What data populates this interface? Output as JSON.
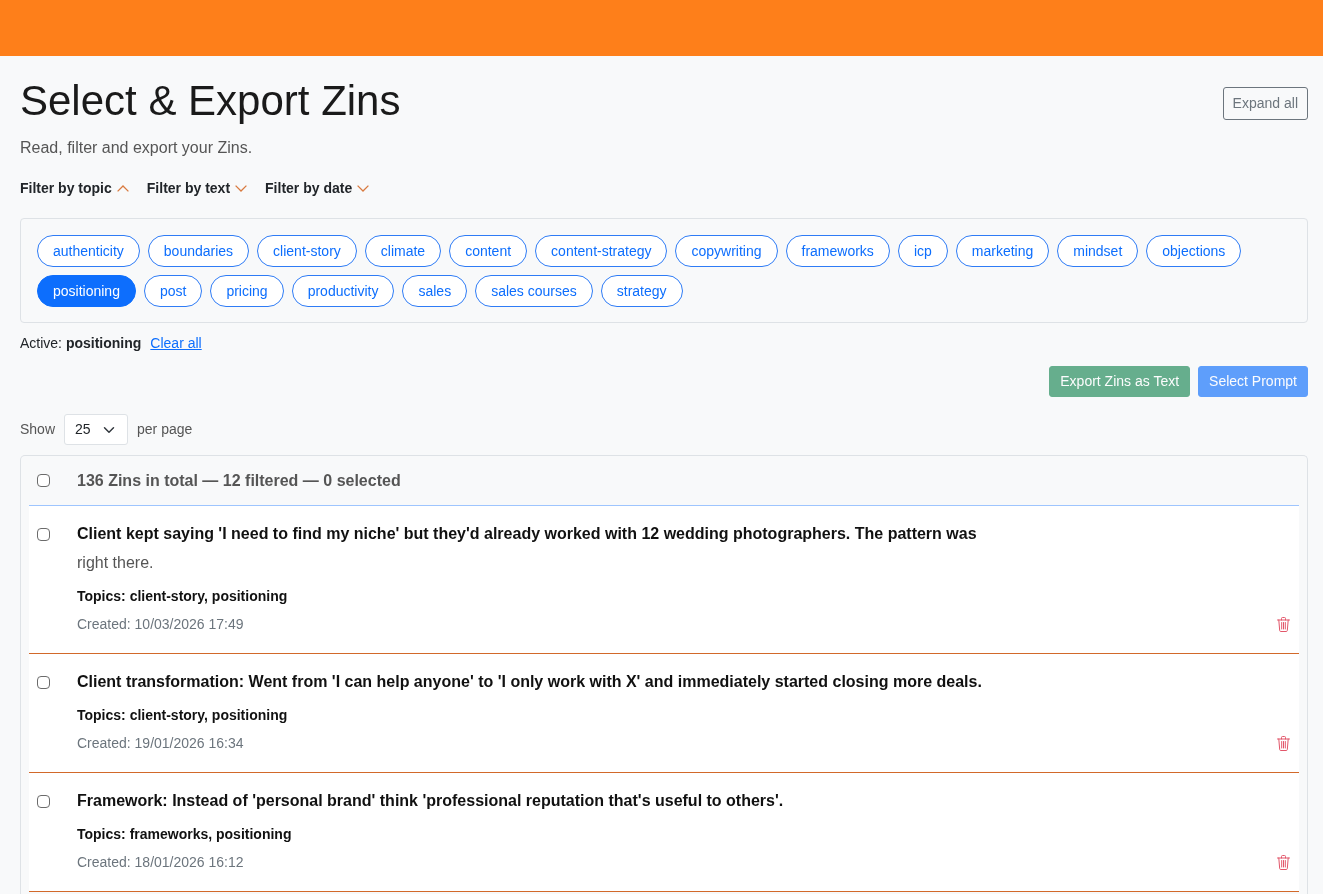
{
  "page": {
    "title": "Select & Export Zins",
    "subtitle": "Read, filter and export your Zins.",
    "expand_button": "Expand all"
  },
  "filters": [
    {
      "kind": "topic",
      "label": "Filter by topic",
      "expanded": true
    },
    {
      "kind": "text",
      "label": "Filter by text",
      "expanded": false
    },
    {
      "kind": "date",
      "label": "Filter by date",
      "expanded": false
    }
  ],
  "topics": [
    {
      "label": "authenticity",
      "selected": false
    },
    {
      "label": "boundaries",
      "selected": false
    },
    {
      "label": "client-story",
      "selected": false
    },
    {
      "label": "climate",
      "selected": false
    },
    {
      "label": "content",
      "selected": false
    },
    {
      "label": "content-strategy",
      "selected": false
    },
    {
      "label": "copywriting",
      "selected": false
    },
    {
      "label": "frameworks",
      "selected": false
    },
    {
      "label": "icp",
      "selected": false
    },
    {
      "label": "marketing",
      "selected": false
    },
    {
      "label": "mindset",
      "selected": false
    },
    {
      "label": "objections",
      "selected": false
    },
    {
      "label": "positioning",
      "selected": true
    },
    {
      "label": "post",
      "selected": false
    },
    {
      "label": "pricing",
      "selected": false
    },
    {
      "label": "productivity",
      "selected": false
    },
    {
      "label": "sales",
      "selected": false
    },
    {
      "label": "sales courses",
      "selected": false
    },
    {
      "label": "strategy",
      "selected": false
    }
  ],
  "active_filter": {
    "text": "Active: **positioning**",
    "clear_link": "Clear all"
  },
  "actions": [
    {
      "kind": "success",
      "label": "Export Zins as Text",
      "disabled": true
    },
    {
      "kind": "primary",
      "label": "Select Prompt",
      "disabled": true
    }
  ],
  "page_size": {
    "label": "Show",
    "value": "25",
    "suffix": "per page"
  },
  "list": {
    "select_all_checked": false,
    "summary": "136 Zins in total — 12 filtered — 0 selected",
    "items": [
      {
        "checked": false,
        "title": "Client kept saying 'I need to find my niche' but they'd already worked with 12 wedding photographers. The pattern was",
        "excerpt": "right there.",
        "topics": "Topics: client-story, positioning",
        "created": "Created: 10/03/2026 17:49"
      },
      {
        "checked": false,
        "title": "Client transformation: Went from 'I can help anyone' to 'I only work with X' and immediately started closing more deals.",
        "topics": "Topics: client-story, positioning",
        "created": "Created: 19/01/2026 16:34"
      },
      {
        "checked": false,
        "title": "Framework: Instead of 'personal brand' think 'professional reputation that's useful to others'.",
        "topics": "Topics: frameworks, positioning",
        "created": "Created: 18/01/2026 16:12"
      }
    ]
  }
}
